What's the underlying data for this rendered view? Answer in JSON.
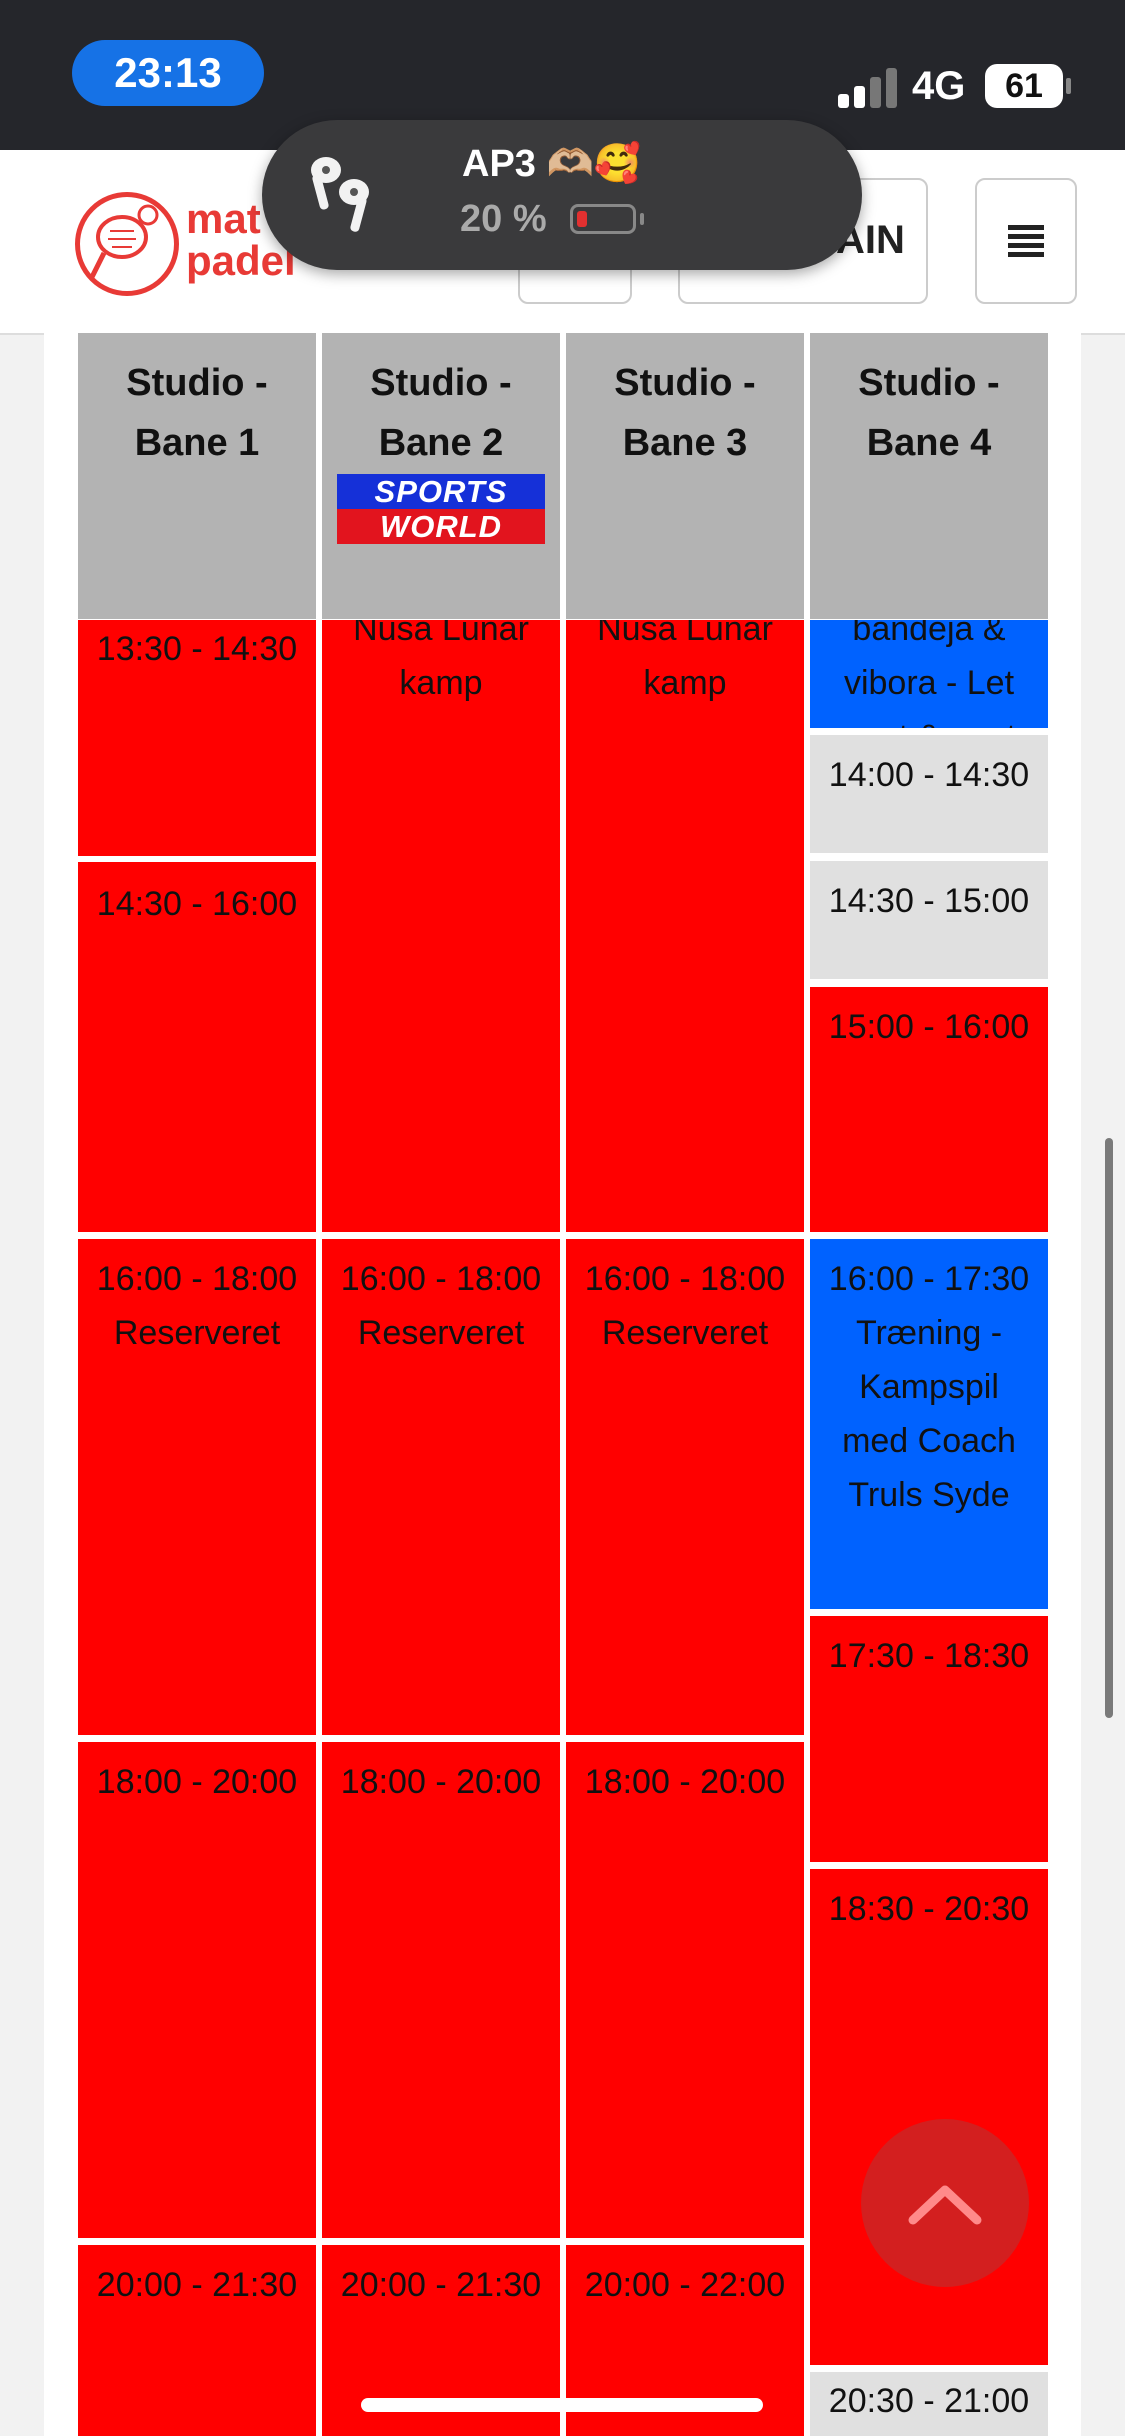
{
  "status_bar": {
    "time": "23:13",
    "network": "4G",
    "battery": "61",
    "signal_bars_active": 2
  },
  "header": {
    "logo_line1": "mat",
    "logo_line2": "padel",
    "login_label": "AIN"
  },
  "airpods_banner": {
    "title": "AP3 🫶🏼🥰",
    "battery_percent": "20 %",
    "battery_level": 0.2
  },
  "schedule": {
    "columns": [
      {
        "title_line1": "Studio -",
        "title_line2": "Bane 1"
      },
      {
        "title_line1": "Studio -",
        "title_line2": "Bane 2"
      },
      {
        "title_line1": "Studio -",
        "title_line2": "Bane 3"
      },
      {
        "title_line1": "Studio -",
        "title_line2": "Bane 4"
      }
    ],
    "sponsor_logo": {
      "line1": "SPORTS",
      "line2": "WORLD"
    },
    "slots": {
      "b1_s1": {
        "time": "13:30 - 14:30",
        "text": ""
      },
      "b1_s2": {
        "time": "14:30 - 16:00",
        "text": ""
      },
      "b1_s3": {
        "time": "16:00 - 18:00",
        "text": "Reserveret"
      },
      "b1_s4": {
        "time": "18:00 - 20:00",
        "text": ""
      },
      "b1_s5": {
        "time": "20:00 - 21:30",
        "text": ""
      },
      "b2_s1": {
        "line1": "Nusa Lunar",
        "line2": "kamp"
      },
      "b2_s2": {
        "time": "16:00 - 18:00",
        "text": "Reserveret"
      },
      "b2_s3": {
        "time": "18:00 - 20:00",
        "text": ""
      },
      "b2_s4": {
        "time": "20:00 - 21:30",
        "text": ""
      },
      "b3_s1": {
        "line1": "Nusa Lunar",
        "line2": "kamp"
      },
      "b3_s2": {
        "time": "16:00 - 18:00",
        "text": "Reserveret"
      },
      "b3_s3": {
        "time": "18:00 - 20:00",
        "text": ""
      },
      "b3_s4": {
        "time": "20:00 - 22:00",
        "text": ""
      },
      "b4_s1": {
        "line1": "bandeja &",
        "line2": "vibora - Let",
        "line3": "øvet & øvet"
      },
      "b4_s2": {
        "time": "14:00 - 14:30"
      },
      "b4_s3": {
        "time": "14:30 - 15:00"
      },
      "b4_s4": {
        "time": "15:00 - 16:00"
      },
      "b4_s5": {
        "time": "16:00 - 17:30",
        "line1": "Træning -",
        "line2": "Kampspil",
        "line3": "med Coach",
        "line4": "Truls Syde"
      },
      "b4_s6": {
        "time": "17:30 - 18:30"
      },
      "b4_s7": {
        "time": "18:30 - 20:30"
      },
      "b4_s8": {
        "time": "20:30 - 21:00"
      }
    }
  },
  "colors": {
    "booked": "#ff0000",
    "training": "#0062ff",
    "free": "#e0e0e0",
    "header_grey": "#b3b3b3",
    "brand": "#e83a36"
  },
  "icons": {
    "back_to_top": "chevron-up-icon",
    "menu": "hamburger-icon",
    "airpods": "airpods-icon"
  }
}
